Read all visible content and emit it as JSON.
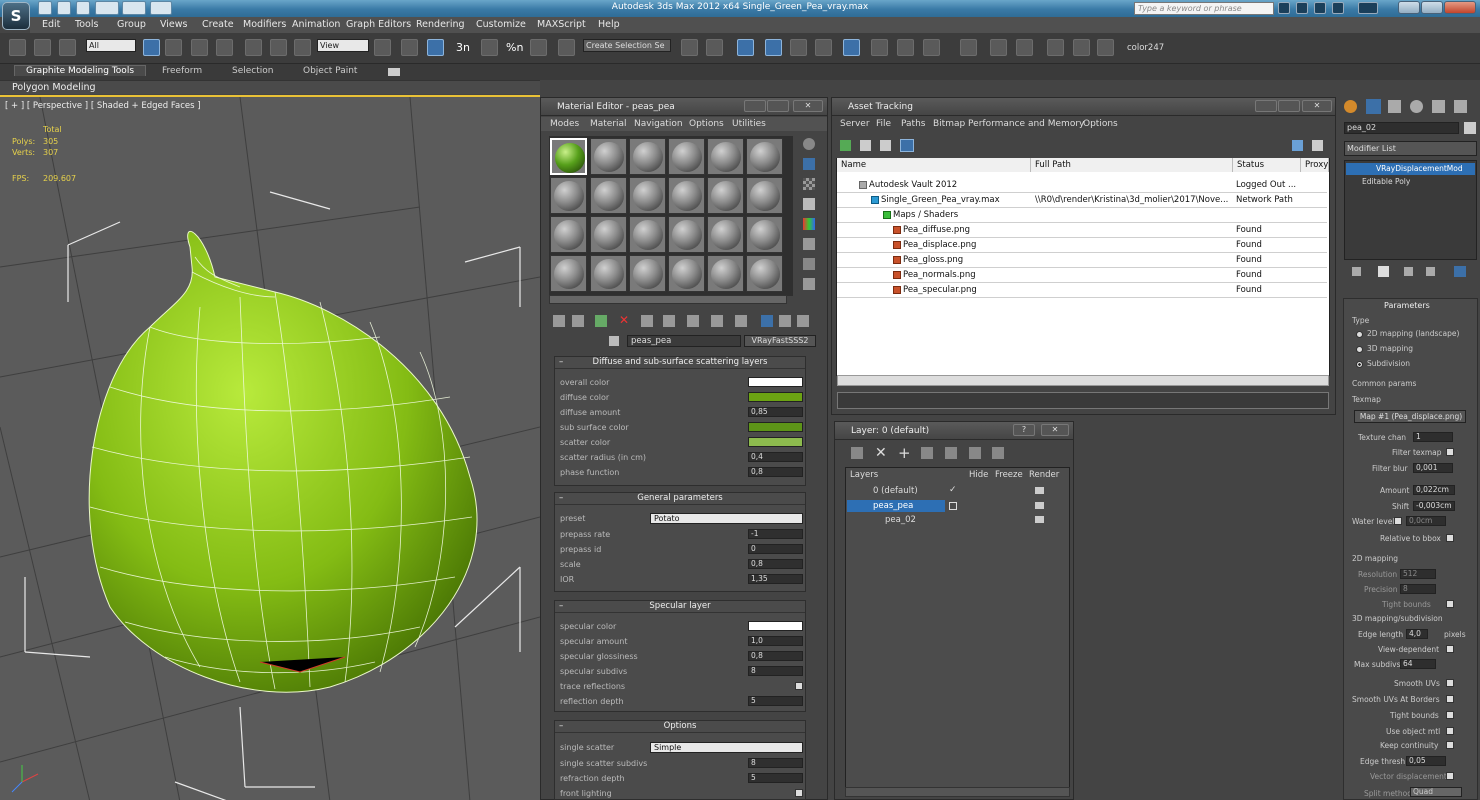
{
  "window": {
    "title": "Autodesk 3ds Max  2012 x64      Single_Green_Pea_vray.max",
    "search_placeholder": "Type a keyword or phrase"
  },
  "menu": [
    "Edit",
    "Tools",
    "Group",
    "Views",
    "Create",
    "Modifiers",
    "Animation",
    "Graph Editors",
    "Rendering",
    "Customize",
    "MAXScript",
    "Help"
  ],
  "toolbar": {
    "filter_value": "All",
    "view_value": "View",
    "snap_labels": [
      "3n",
      "%n"
    ],
    "selection_set_placeholder": "Create Selection Se",
    "color_label": "color247"
  },
  "ribbon": {
    "tabs": [
      "Graphite Modeling Tools",
      "Freeform",
      "Selection",
      "Object Paint"
    ],
    "sub_label": "Polygon Modeling"
  },
  "viewport": {
    "label": "[ + ] [ Perspective ] [ Shaded + Edged Faces ]",
    "stats_header": "Total",
    "polys_label": "Polys:",
    "polys_value": "305",
    "verts_label": "Verts:",
    "verts_value": "307",
    "fps_label": "FPS:",
    "fps_value": "209.607"
  },
  "material_editor": {
    "title": "Material Editor - peas_pea",
    "menu": [
      "Modes",
      "Material",
      "Navigation",
      "Options",
      "Utilities"
    ],
    "material_name": "peas_pea",
    "material_type": "VRayFastSSS2",
    "rollouts": {
      "diffuse": {
        "title": "Diffuse and sub-surface scattering layers",
        "rows": [
          {
            "label": "overall color",
            "value": "",
            "color": "#ffffff"
          },
          {
            "label": "diffuse color",
            "value": "",
            "color": "#6ca313"
          },
          {
            "label": "diffuse amount",
            "value": "0,85",
            "color": ""
          },
          {
            "label": "sub surface color",
            "value": "",
            "color": "#5d9418"
          },
          {
            "label": "scatter color",
            "value": "",
            "color": "#8dbb4e"
          },
          {
            "label": "scatter radius (in cm)",
            "value": "0,4",
            "color": ""
          },
          {
            "label": "phase function",
            "value": "0,8",
            "color": ""
          }
        ]
      },
      "general": {
        "title": "General parameters",
        "preset_label": "preset",
        "preset_value": "Potato",
        "rows": [
          {
            "label": "prepass rate",
            "value": "-1"
          },
          {
            "label": "prepass id",
            "value": "0"
          },
          {
            "label": "scale",
            "value": "0,8"
          },
          {
            "label": "IOR",
            "value": "1,35"
          }
        ]
      },
      "specular": {
        "title": "Specular layer",
        "rows": [
          {
            "label": "specular color",
            "value": "",
            "color": "#ffffff"
          },
          {
            "label": "specular amount",
            "value": "1,0",
            "color": ""
          },
          {
            "label": "specular glossiness",
            "value": "0,8",
            "color": ""
          },
          {
            "label": "specular subdivs",
            "value": "8",
            "color": ""
          }
        ],
        "trace_label": "trace reflections",
        "depth_label": "reflection depth",
        "depth_value": "5"
      },
      "options": {
        "title": "Options",
        "single_scatter_label": "single scatter",
        "single_scatter_value": "Simple",
        "rows": [
          {
            "label": "single scatter subdivs",
            "value": "8"
          },
          {
            "label": "refraction depth",
            "value": "5"
          }
        ],
        "front_label": "front lighting"
      }
    }
  },
  "asset_tracking": {
    "title": "Asset Tracking",
    "menu": [
      "Server",
      "File",
      "Paths",
      "Bitmap Performance and Memory",
      "Options"
    ],
    "columns": [
      "Name",
      "Full Path",
      "Status",
      "Proxy"
    ],
    "rows": [
      {
        "name": "Autodesk Vault 2012",
        "path": "",
        "status": "Logged Out ..."
      },
      {
        "name": "Single_Green_Pea_vray.max",
        "path": "\\\\R0\\d\\render\\Kristina\\3d_molier\\2017\\Nove...",
        "status": "Network Path"
      },
      {
        "name": "Maps / Shaders",
        "path": "",
        "status": ""
      },
      {
        "name": "Pea_diffuse.png",
        "path": "",
        "status": "Found"
      },
      {
        "name": "Pea_displace.png",
        "path": "",
        "status": "Found"
      },
      {
        "name": "Pea_gloss.png",
        "path": "",
        "status": "Found"
      },
      {
        "name": "Pea_normals.png",
        "path": "",
        "status": "Found"
      },
      {
        "name": "Pea_specular.png",
        "path": "",
        "status": "Found"
      }
    ]
  },
  "layer_panel": {
    "title": "Layer: 0 (default)",
    "help": "?",
    "columns": [
      "Layers",
      "Hide",
      "Freeze",
      "Render"
    ],
    "rows": [
      {
        "name": "0 (default)"
      },
      {
        "name": "peas_pea"
      },
      {
        "name": "pea_02"
      }
    ]
  },
  "command_panel": {
    "object_name": "pea_02",
    "modifier_list_label": "Modifier List",
    "stack": [
      "VRayDisplacementMod",
      "Editable Poly"
    ],
    "parameters_title": "Parameters",
    "type_label": "Type",
    "type_options": [
      "2D mapping (landscape)",
      "3D mapping",
      "Subdivision"
    ],
    "common_label": "Common params",
    "texmap_label": "Texmap",
    "texmap_value": "Map #1 (Pea_displace.png)",
    "texture_chan_label": "Texture chan",
    "texture_chan_value": "1",
    "filter_texmap_label": "Filter texmap",
    "filter_blur_label": "Filter blur",
    "filter_blur_value": "0,001",
    "amount_label": "Amount",
    "amount_value": "0,022cm",
    "shift_label": "Shift",
    "shift_value": "-0,003cm",
    "water_level_label": "Water level",
    "water_level_value": "0,0cm",
    "relative_label": "Relative to bbox",
    "mapping2d_label": "2D mapping",
    "resolution_label": "Resolution",
    "resolution_value": "512",
    "precision_label": "Precision",
    "precision_value": "8",
    "tight_label": "Tight bounds",
    "mapping3d_label": "3D mapping/subdivision",
    "edge_length_label": "Edge length",
    "edge_length_value": "4,0",
    "pixels_label": "pixels",
    "view_dep_label": "View-dependent",
    "max_subdivs_label": "Max subdivs",
    "max_subdivs_value": "64",
    "smooth_uv_label": "Smooth UVs",
    "smooth_uv_borders_label": "Smooth UVs At Borders",
    "tight2_label": "Tight bounds",
    "use_mtl_label": "Use object mtl",
    "keep_cont_label": "Keep continuity",
    "edge_thresh_label": "Edge thresh",
    "edge_thresh_value": "0,05",
    "vector_disp_label": "Vector displacement",
    "split_label": "Split method",
    "split_value": "Quad"
  }
}
